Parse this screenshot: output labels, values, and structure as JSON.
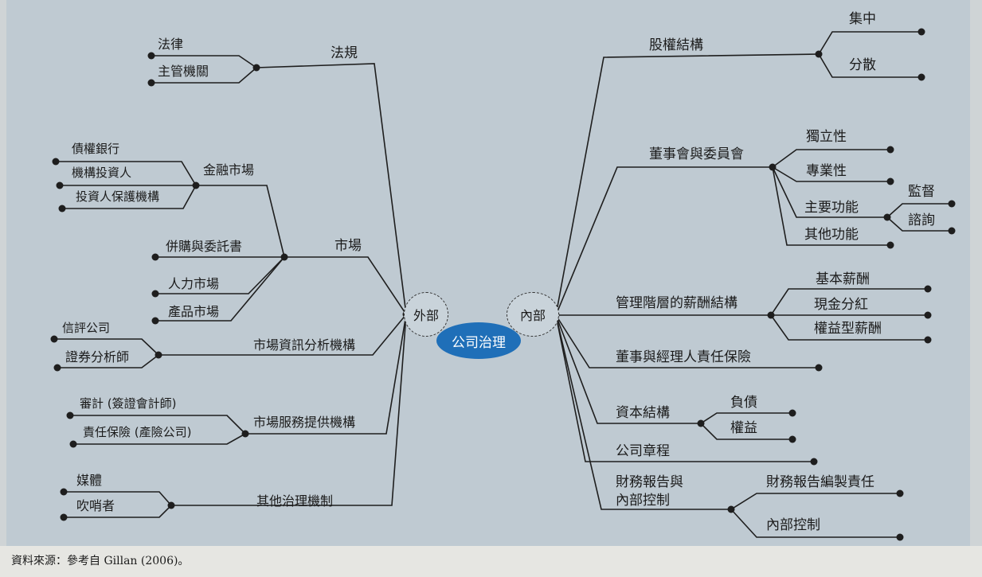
{
  "center": "公司治理",
  "external": "外部",
  "internal": "內部",
  "external_branches": {
    "regulation": {
      "label": "法規",
      "children": [
        "法律",
        "主管機關"
      ]
    },
    "market": {
      "label": "市場",
      "financial_market": {
        "label": "金融市場",
        "children": [
          "債權銀行",
          "機構投資人",
          "投資人保護機構"
        ]
      },
      "children": [
        "併購與委託書",
        "人力市場",
        "產品市場"
      ]
    },
    "info_analysis": {
      "label": "市場資訊分析機構",
      "children": [
        "信評公司",
        "證券分析師"
      ]
    },
    "service_providers": {
      "label": "市場服務提供機構",
      "children": [
        "審計 (簽證會計師)",
        "責任保險 (產險公司)"
      ]
    },
    "other_mechanisms": {
      "label": "其他治理機制",
      "children": [
        "媒體",
        "吹哨者"
      ]
    }
  },
  "internal_branches": {
    "ownership": {
      "label": "股權結構",
      "children": [
        "集中",
        "分散"
      ]
    },
    "board": {
      "label": "董事會與委員會",
      "children": [
        "獨立性",
        "專業性",
        "主要功能",
        "其他功能"
      ],
      "main_function_children": [
        "監督",
        "諮詢"
      ]
    },
    "compensation": {
      "label": "管理階層的薪酬結構",
      "children": [
        "基本薪酬",
        "現金分紅",
        "權益型薪酬"
      ]
    },
    "insurance": {
      "label": "董事與經理人責任保險"
    },
    "capital": {
      "label": "資本結構",
      "children": [
        "負債",
        "權益"
      ]
    },
    "charter": {
      "label": "公司章程"
    },
    "reporting": {
      "label_line1": "財務報告與",
      "label_line2": "內部控制",
      "children": [
        "財務報告編製責任",
        "內部控制"
      ]
    }
  },
  "source": "資料來源：參考自 Gillan (2006)。"
}
